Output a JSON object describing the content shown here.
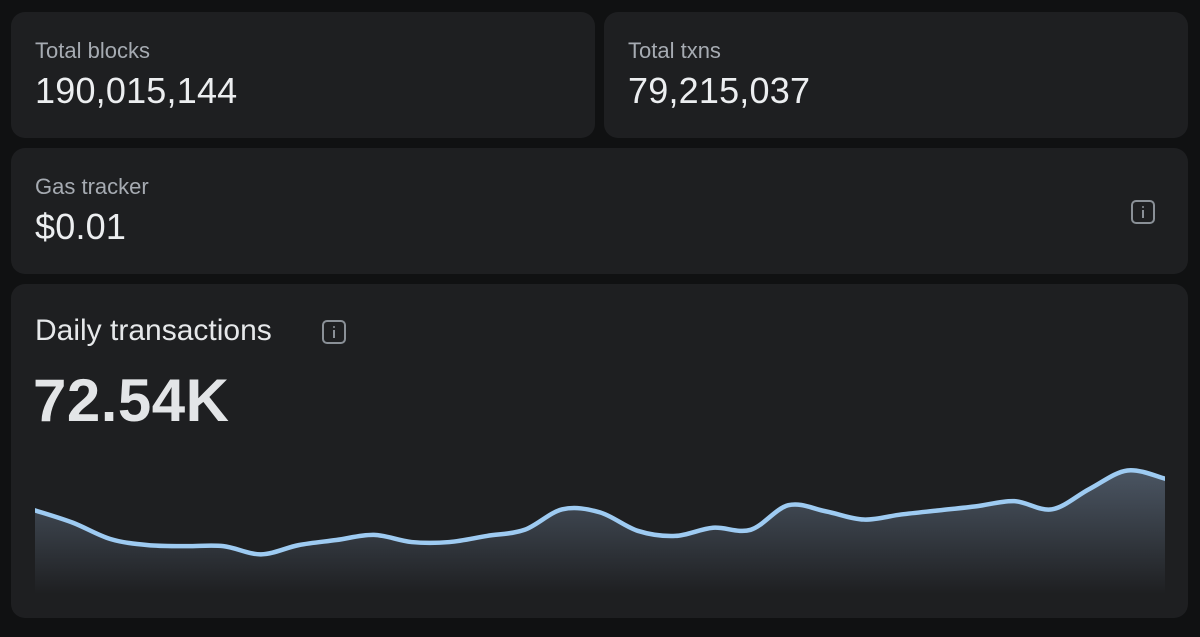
{
  "stats": {
    "total_blocks": {
      "label": "Total blocks",
      "value": "190,015,144"
    },
    "total_txns": {
      "label": "Total txns",
      "value": "79,215,037"
    },
    "gas_tracker": {
      "label": "Gas tracker",
      "value": "$0.01",
      "icon": "info-icon"
    }
  },
  "daily_transactions": {
    "title": "Daily transactions",
    "value": "72.54K",
    "icon": "info-icon"
  },
  "colors": {
    "background": "#101112",
    "card": "#1e1f21",
    "line": "#9ecbf2",
    "label": "#a6abb2",
    "value": "#eceef0"
  },
  "chart_data": {
    "type": "area",
    "title": "",
    "xlabel": "",
    "ylabel": "",
    "grid": false,
    "legend": "none",
    "ylim": [
      0,
      100
    ],
    "values": [
      72,
      60,
      44,
      38,
      37,
      37,
      29,
      38,
      43,
      48,
      41,
      41,
      47,
      53,
      73,
      70,
      52,
      47,
      55,
      53,
      77,
      71,
      63,
      68,
      72,
      76,
      81,
      73,
      93,
      111,
      103
    ],
    "series": [
      {
        "values": [
          72,
          60,
          44,
          38,
          37,
          37,
          29,
          38,
          43,
          48,
          41,
          41,
          47,
          53,
          73,
          70,
          52,
          47,
          55,
          53,
          77,
          71,
          63,
          68,
          72,
          76,
          81,
          73,
          93,
          111,
          103
        ]
      }
    ]
  }
}
